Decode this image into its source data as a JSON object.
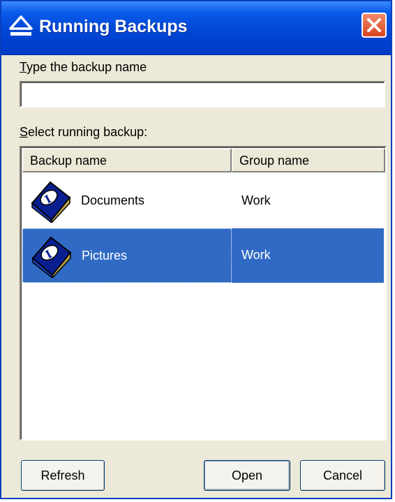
{
  "window": {
    "title": "Running Backups",
    "title_icon": "eject-icon",
    "close_icon": "close-icon"
  },
  "name_field": {
    "label": "Type the backup name",
    "value": "",
    "placeholder": ""
  },
  "list": {
    "label": "Select running backup:",
    "columns": [
      "Backup name",
      "Group name"
    ],
    "rows": [
      {
        "name": "Documents",
        "group": "Work",
        "icon": "backup-book-icon",
        "selected": false
      },
      {
        "name": "Pictures",
        "group": "Work",
        "icon": "backup-book-icon",
        "selected": true
      }
    ]
  },
  "buttons": {
    "refresh": "Refresh",
    "open": "Open",
    "cancel": "Cancel"
  },
  "colors": {
    "titlebar": "#0046d5",
    "selection": "#316ac5",
    "dialog_bg": "#ece9d8",
    "close_button": "#d9441f"
  }
}
